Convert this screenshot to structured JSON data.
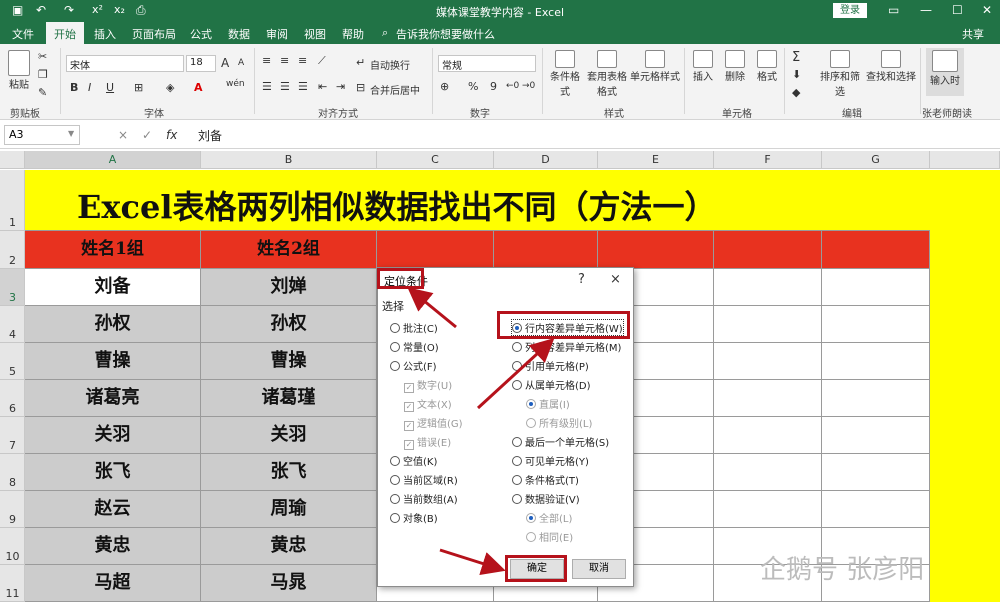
{
  "titlebar": {
    "title": "媒体课堂教学内容 - Excel",
    "login": "登录",
    "quick": [
      "save-icon",
      "undo-icon",
      "redo-icon",
      "superscript-icon",
      "subscript-icon",
      "print-preview-icon"
    ]
  },
  "tabs": [
    "文件",
    "开始",
    "插入",
    "页面布局",
    "公式",
    "数据",
    "审阅",
    "视图",
    "帮助",
    "告诉我你想要做什么",
    "共享"
  ],
  "ribbon": {
    "groups": [
      "剪贴板",
      "字体",
      "对齐方式",
      "数字",
      "样式",
      "单元格",
      "编辑",
      "张老师朗读"
    ],
    "paste": "粘贴",
    "font_name": "宋体",
    "font_size": "18",
    "bold": "B",
    "italic": "I",
    "underline": "U",
    "font_grow": "A",
    "font_shrink": "A",
    "wen": "wén",
    "wrap": "自动换行",
    "merge": "合并后居中",
    "number_format": "常规",
    "percent": "%",
    "comma": "9",
    "cond_format": "条件格式",
    "table_format": "套用表格格式",
    "cell_style": "单元格样式",
    "insert": "插入",
    "delete": "删除",
    "format": "格式",
    "sort_filter": "排序和筛选",
    "find_select": "查找和选择",
    "read": "输入时"
  },
  "formula_bar": {
    "name_box": "A3",
    "cancel": "×",
    "enter": "✓",
    "fx": "fx",
    "value": "刘备"
  },
  "grid": {
    "columns": [
      "A",
      "B",
      "C",
      "D",
      "E",
      "F",
      "G"
    ],
    "rows": [
      "1",
      "2",
      "3",
      "4",
      "5",
      "6",
      "7",
      "8",
      "9",
      "10",
      "11"
    ],
    "title": "Excel表格两列相似数据找出不同（方法一）",
    "headers": [
      "姓名1组",
      "姓名2组"
    ],
    "data": [
      [
        "刘备",
        "刘婵"
      ],
      [
        "孙权",
        "孙权"
      ],
      [
        "曹操",
        "曹操"
      ],
      [
        "诸葛亮",
        "诸葛瑾"
      ],
      [
        "关羽",
        "关羽"
      ],
      [
        "张飞",
        "张飞"
      ],
      [
        "赵云",
        "周瑜"
      ],
      [
        "黄忠",
        "黄忠"
      ],
      [
        "马超",
        "马晁"
      ]
    ]
  },
  "colors": {
    "excel_green": "#217346",
    "header_red": "#e8321f",
    "title_yellow": "#ffff00",
    "data_gray": "#cccccc",
    "highlight_red": "#b5121b"
  },
  "dialog": {
    "title": "定位条件",
    "help": "?",
    "close": "×",
    "section": "选择",
    "left_options": [
      {
        "label": "批注(C)",
        "type": "radio",
        "checked": false,
        "disabled": false
      },
      {
        "label": "常量(O)",
        "type": "radio",
        "checked": false,
        "disabled": false
      },
      {
        "label": "公式(F)",
        "type": "radio",
        "checked": false,
        "disabled": false
      },
      {
        "label": "数字(U)",
        "type": "check",
        "checked": true,
        "disabled": true
      },
      {
        "label": "文本(X)",
        "type": "check",
        "checked": true,
        "disabled": true
      },
      {
        "label": "逻辑值(G)",
        "type": "check",
        "checked": true,
        "disabled": true
      },
      {
        "label": "错误(E)",
        "type": "check",
        "checked": true,
        "disabled": true
      },
      {
        "label": "空值(K)",
        "type": "radio",
        "checked": false,
        "disabled": false
      },
      {
        "label": "当前区域(R)",
        "type": "radio",
        "checked": false,
        "disabled": false
      },
      {
        "label": "当前数组(A)",
        "type": "radio",
        "checked": false,
        "disabled": false
      },
      {
        "label": "对象(B)",
        "type": "radio",
        "checked": false,
        "disabled": false
      }
    ],
    "right_options": [
      {
        "label": "行内容差异单元格(W)",
        "type": "radio",
        "checked": true,
        "disabled": false
      },
      {
        "label": "列内容差异单元格(M)",
        "type": "radio",
        "checked": false,
        "disabled": false
      },
      {
        "label": "引用单元格(P)",
        "type": "radio",
        "checked": false,
        "disabled": false
      },
      {
        "label": "从属单元格(D)",
        "type": "radio",
        "checked": false,
        "disabled": false
      },
      {
        "label": "直属(I)",
        "type": "radio",
        "checked": true,
        "disabled": true
      },
      {
        "label": "所有级别(L)",
        "type": "radio",
        "checked": false,
        "disabled": true
      },
      {
        "label": "最后一个单元格(S)",
        "type": "radio",
        "checked": false,
        "disabled": false
      },
      {
        "label": "可见单元格(Y)",
        "type": "radio",
        "checked": false,
        "disabled": false
      },
      {
        "label": "条件格式(T)",
        "type": "radio",
        "checked": false,
        "disabled": false
      },
      {
        "label": "数据验证(V)",
        "type": "radio",
        "checked": false,
        "disabled": false
      },
      {
        "label": "全部(L)",
        "type": "radio",
        "checked": true,
        "disabled": true
      },
      {
        "label": "相同(E)",
        "type": "radio",
        "checked": false,
        "disabled": true
      }
    ],
    "ok": "确定",
    "cancel": "取消"
  },
  "watermark": "企鹅号 张彦阳"
}
